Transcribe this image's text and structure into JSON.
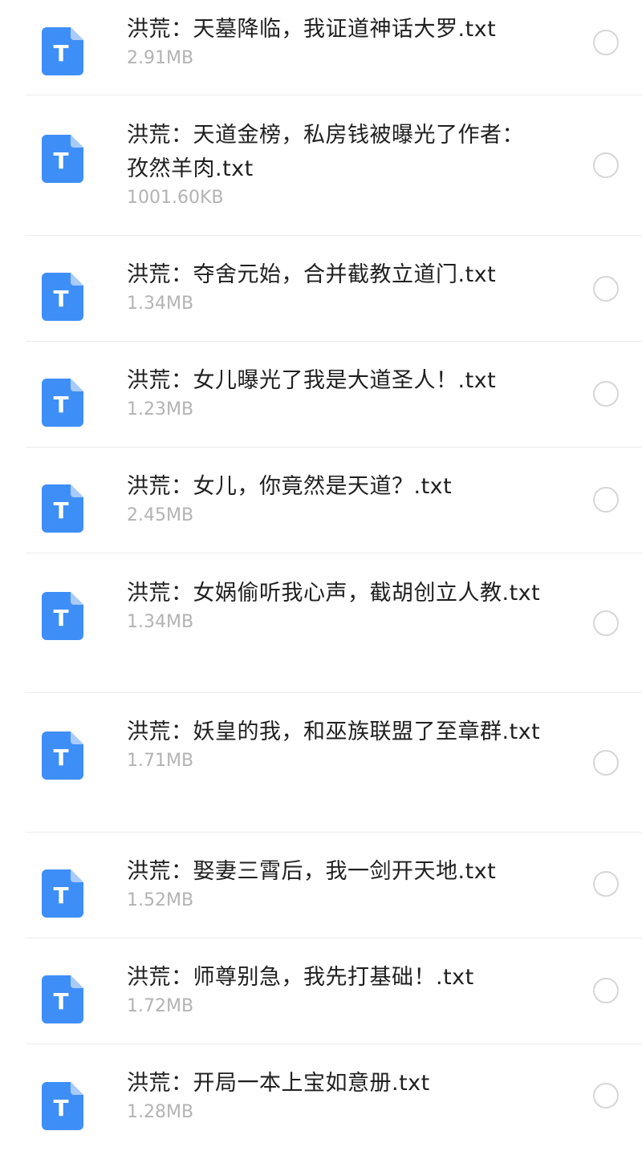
{
  "theme": {
    "icon_color": "#3e8ef7",
    "icon_fold_color": "#a9cbfb",
    "icon_letter_color": "#ffffff",
    "name_color": "#1f1f1f",
    "size_color": "#b3b3b3",
    "radio_border_color": "#d6d6d6"
  },
  "files": [
    {
      "icon": "txt-file-icon",
      "icon_letter": "T",
      "name": "洪荒：天墓降临，我证道神话大罗.txt",
      "size": "2.91MB",
      "selected": false
    },
    {
      "icon": "txt-file-icon",
      "icon_letter": "T",
      "name": "洪荒：天道金榜，私房钱被曝光了作者：孜然羊肉.txt",
      "size": "1001.60KB",
      "selected": false
    },
    {
      "icon": "txt-file-icon",
      "icon_letter": "T",
      "name": "洪荒：夺舍元始，合并截教立道门.txt",
      "size": "1.34MB",
      "selected": false
    },
    {
      "icon": "txt-file-icon",
      "icon_letter": "T",
      "name": "洪荒：女儿曝光了我是大道圣人！.txt",
      "size": "1.23MB",
      "selected": false
    },
    {
      "icon": "txt-file-icon",
      "icon_letter": "T",
      "name": "洪荒：女儿，你竟然是天道？.txt",
      "size": "2.45MB",
      "selected": false
    },
    {
      "icon": "txt-file-icon",
      "icon_letter": "T",
      "name": "洪荒：女娲偷听我心声，截胡创立人教.txt",
      "size": "1.34MB",
      "selected": false
    },
    {
      "icon": "txt-file-icon",
      "icon_letter": "T",
      "name": "洪荒：妖皇的我，和巫族联盟了至章群.txt",
      "size": "1.71MB",
      "selected": false
    },
    {
      "icon": "txt-file-icon",
      "icon_letter": "T",
      "name": "洪荒：娶妻三霄后，我一剑开天地.txt",
      "size": "1.52MB",
      "selected": false
    },
    {
      "icon": "txt-file-icon",
      "icon_letter": "T",
      "name": "洪荒：师尊别急，我先打基础！.txt",
      "size": "1.72MB",
      "selected": false
    },
    {
      "icon": "txt-file-icon",
      "icon_letter": "T",
      "name": "洪荒：开局一本上宝如意册.txt",
      "size": "1.28MB",
      "selected": false
    }
  ]
}
